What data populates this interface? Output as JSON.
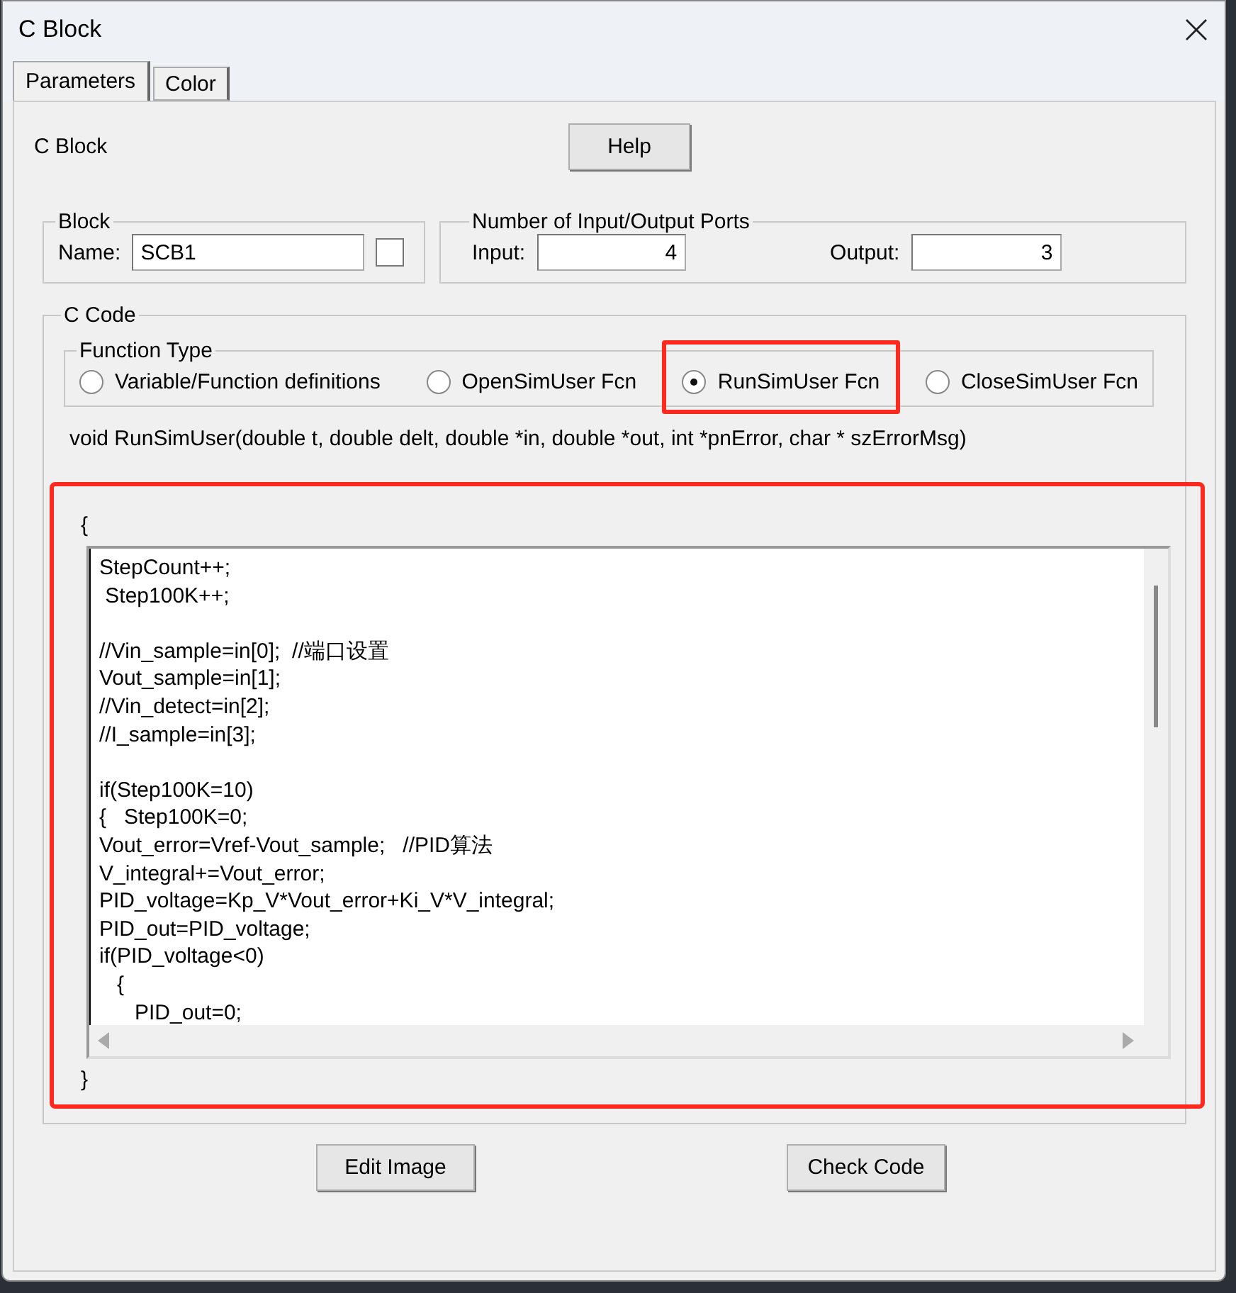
{
  "window": {
    "title": "C Block"
  },
  "tabs": [
    {
      "label": "Parameters",
      "selected": true
    },
    {
      "label": "Color",
      "selected": false
    }
  ],
  "heading": "C Block",
  "help_button": "Help",
  "block_group": {
    "title": "Block",
    "name_label": "Name:",
    "name_value": "SCB1",
    "checked": false
  },
  "ports_group": {
    "title": "Number of Input/Output Ports",
    "input_label": "Input:",
    "input_value": "4",
    "output_label": "Output:",
    "output_value": "3"
  },
  "code_group": {
    "title": "C Code",
    "function_type": {
      "title": "Function Type",
      "options": [
        {
          "label": "Variable/Function definitions",
          "selected": false,
          "highlighted": false
        },
        {
          "label": "OpenSimUser Fcn",
          "selected": false,
          "highlighted": false
        },
        {
          "label": "RunSimUser Fcn",
          "selected": true,
          "highlighted": true
        },
        {
          "label": "CloseSimUser Fcn",
          "selected": false,
          "highlighted": false
        }
      ]
    },
    "signature": "void RunSimUser(double t, double delt, double *in, double *out, int *pnError, char * szErrorMsg)",
    "open_brace": "{",
    "code_editor": {
      "highlighted": true,
      "code": "StepCount++;\n Step100K++;\n\n//Vin_sample=in[0];  //端口设置\nVout_sample=in[1];\n//Vin_detect=in[2];\n//I_sample=in[3];\n\nif(Step100K=10)\n{   Step100K=0;\nVout_error=Vref-Vout_sample;   //PID算法\nV_integral+=Vout_error;\nPID_voltage=Kp_V*Vout_error+Ki_V*V_integral;\nPID_out=PID_voltage;\nif(PID_voltage<0)\n   {\n      PID_out=0;"
    },
    "close_brace": "}"
  },
  "buttons": [
    "Edit Image",
    "Check Code"
  ]
}
